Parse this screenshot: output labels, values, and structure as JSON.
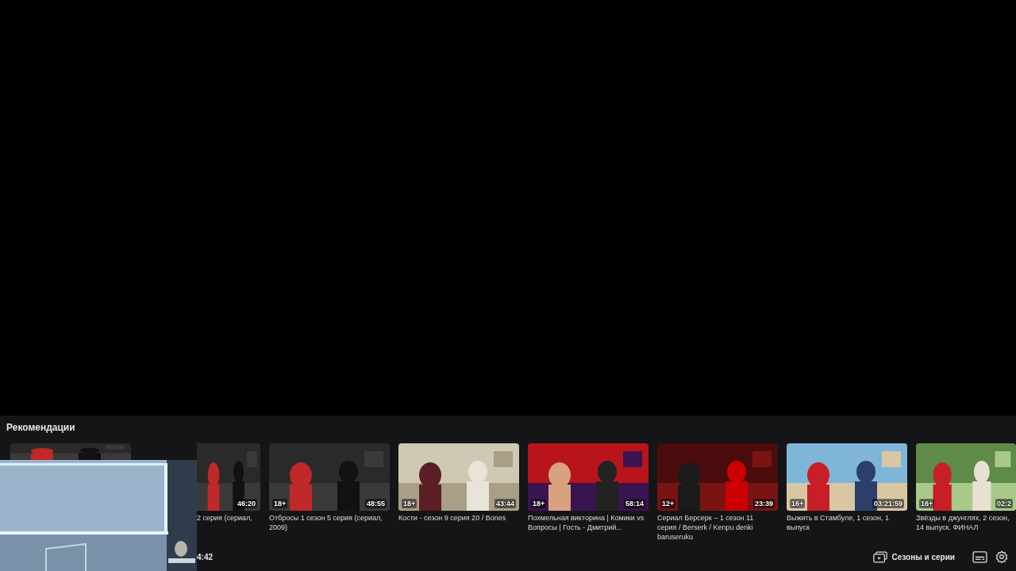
{
  "recommendations": {
    "title": "Рекомендации",
    "cards": [
      {
        "kind": "strip"
      },
      {
        "kind": "covered",
        "title": "2 серия (сериал,",
        "duration": "46:20"
      },
      {
        "kind": "full",
        "title": "Отбросы 1 сезон 5 серия (сериал, 2009)",
        "age": "18+",
        "duration": "48:55"
      },
      {
        "kind": "full",
        "title": "Кости - сезон 9 серия 20 / Bones",
        "age": "18+",
        "duration": "43:44"
      },
      {
        "kind": "full",
        "title": "Похмельная викторина | Комики vs Вопросы | Гость - Дмитрий...",
        "age": "18+",
        "duration": "58:14"
      },
      {
        "kind": "full",
        "title": "Сериал Берсерк – 1 сезон 11 серия / Berserk / Kenpu denki baruseruku",
        "age": "12+",
        "duration": "23:39"
      },
      {
        "kind": "full",
        "title": "Выжить в Стамбуле, 1 сезон, 1 выпуск",
        "age": "16+",
        "duration": "03:21:59"
      },
      {
        "kind": "full",
        "title": "Звёзды в джунглях, 2 сезон, 14 выпуск. ФИНАЛ",
        "age": "16+",
        "duration": "02:2"
      }
    ]
  },
  "controls": {
    "time": "4:42",
    "seasons_button": "Сезоны и серии"
  }
}
